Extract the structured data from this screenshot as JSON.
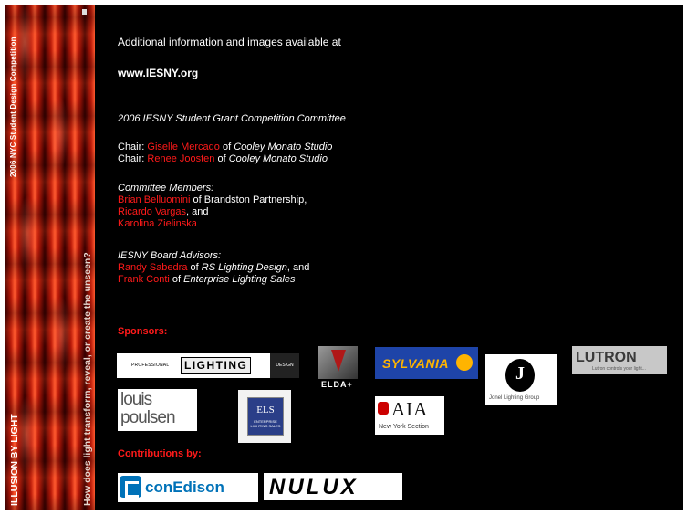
{
  "banner": {
    "vertical_top": "2006 NYC Student Design Competition",
    "vertical_middle": "How does light transform, reveal, or create the unseen?",
    "vertical_bottom": "ILLUSION BY LIGHT"
  },
  "intro": {
    "line": "Additional information and images available at",
    "url": "www.IESNY.org"
  },
  "committee": {
    "title": "2006 IESNY Student Grant Competition Committee",
    "chairs": [
      {
        "label": "Chair: ",
        "name": "Giselle Mercado",
        "of": " of ",
        "org": "Cooley Monato Studio"
      },
      {
        "label": "Chair: ",
        "name": "Renee Joosten",
        "of": " of ",
        "org": "Cooley Monato Studio"
      }
    ],
    "members_title": "Committee Members:",
    "members": {
      "m1_name": "Brian Belluomini",
      "m1_rest": " of Brandston Partnership,",
      "m2_name": "Ricardo Vargas",
      "m2_rest": ", and",
      "m3_name": "Karolina Zielinska"
    },
    "advisors_title": "IESNY Board Advisors:",
    "advisors": {
      "a1_name": "Randy Sabedra",
      "a1_of": " of ",
      "a1_org": "RS Lighting Design",
      "a1_rest": ", and",
      "a2_name": "Frank Conti",
      "a2_of": " of ",
      "a2_org": "Enterprise Lighting Sales"
    }
  },
  "sponsors": {
    "heading": "Sponsors:",
    "pld": {
      "small": "PROFESSIONAL",
      "main": "LIGHTING",
      "tail": "DESIGN"
    },
    "elda": "ELDA+",
    "sylvania": "SYLVANIA",
    "jll": "Jonel Lighting Group",
    "lutron": {
      "main": "LUTRON",
      "tagline": "Lutron controls your light..."
    },
    "louis_poulsen": {
      "l1": "louis",
      "l2": "poulsen"
    },
    "els": {
      "main": "ELS",
      "sub": "ENTERPRISE LIGHTING SALES"
    },
    "aia": {
      "main": "AIA",
      "sub": "New York Section"
    }
  },
  "contributions": {
    "heading": "Contributions by:",
    "coned": "conEdison",
    "nulux": "NULUX"
  },
  "colors": {
    "background": "#000000",
    "text": "#ffffff",
    "accent": "#ff1a1a"
  }
}
